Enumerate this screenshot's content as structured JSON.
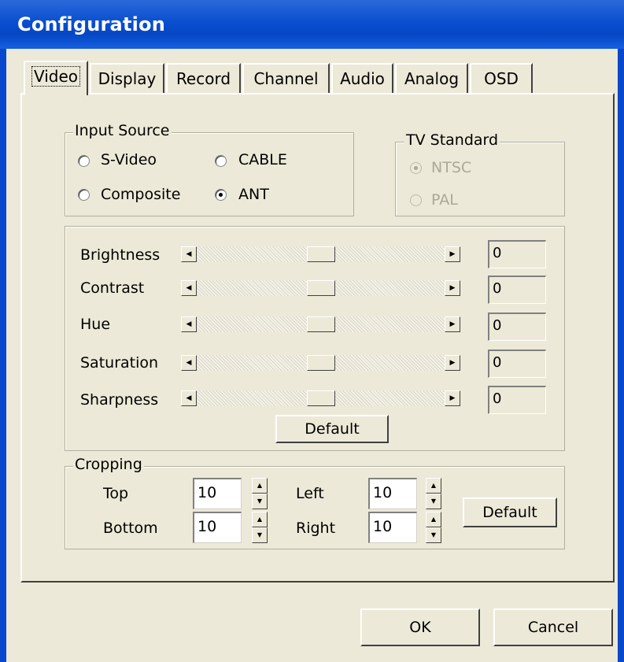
{
  "window": {
    "title": "Configuration"
  },
  "tabs": [
    "Video",
    "Display",
    "Record",
    "Channel",
    "Audio",
    "Analog",
    "OSD"
  ],
  "active_tab": "Video",
  "input_source": {
    "legend": "Input Source",
    "options": [
      "S-Video",
      "CABLE",
      "Composite",
      "ANT"
    ],
    "selected": "ANT"
  },
  "tv_standard": {
    "legend": "TV Standard",
    "options": [
      "NTSC",
      "PAL"
    ],
    "selected": "NTSC",
    "enabled": false
  },
  "sliders": [
    {
      "label": "Brightness",
      "value": "0"
    },
    {
      "label": "Contrast",
      "value": "0"
    },
    {
      "label": "Hue",
      "value": "0"
    },
    {
      "label": "Saturation",
      "value": "0"
    },
    {
      "label": "Sharpness",
      "value": "0"
    }
  ],
  "video_default_button": "Default",
  "cropping": {
    "legend": "Cropping",
    "top_label": "Top",
    "top_value": "10",
    "bottom_label": "Bottom",
    "bottom_value": "10",
    "left_label": "Left",
    "left_value": "10",
    "right_label": "Right",
    "right_value": "10",
    "default_button": "Default"
  },
  "buttons": {
    "ok": "OK",
    "cancel": "Cancel"
  },
  "icons": {
    "scroll_left": "arrow-left-icon",
    "scroll_right": "arrow-right-icon",
    "spin_up": "spin-up-icon",
    "spin_down": "spin-down-icon"
  },
  "colors": {
    "titlebar": "#0a4fd0",
    "face": "#ece9d8",
    "disabled_text": "#aca899"
  }
}
